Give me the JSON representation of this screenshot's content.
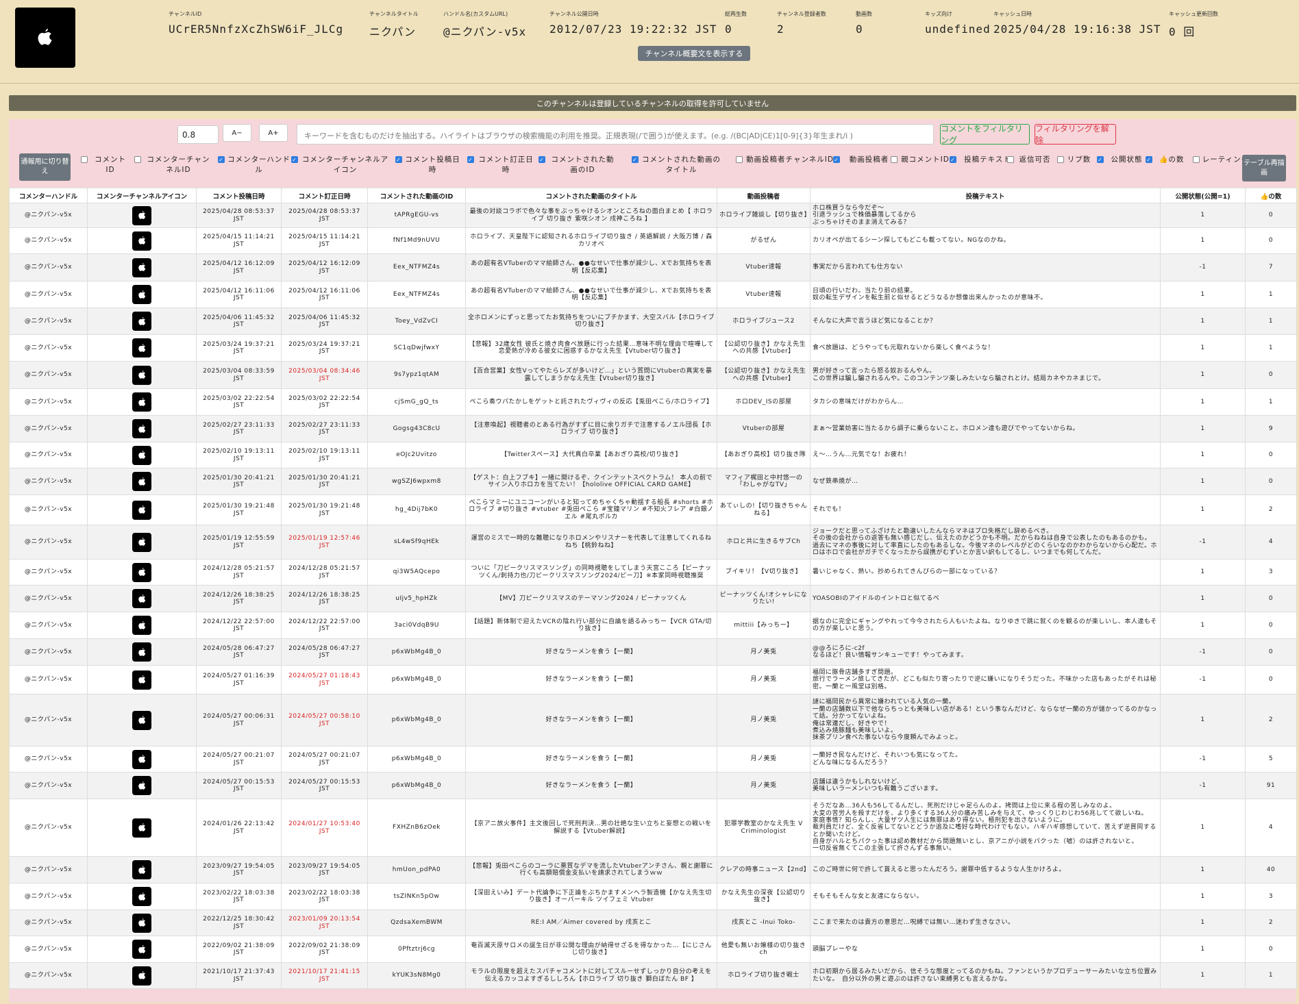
{
  "channel": {
    "icon": "apple-icon",
    "fields": [
      {
        "label": "チャンネルID",
        "value": "UCrER5NnfzXcZhSW6iF_JLCg"
      },
      {
        "label": "チャンネルタイトル",
        "value": "ニクパン"
      },
      {
        "label": "ハンドル名(カスタムURL)",
        "value": "@ニクパン-v5x"
      },
      {
        "label": "チャンネル公開日時",
        "value": "2012/07/23 19:22:32 JST"
      },
      {
        "label": "総再生数",
        "value": "0"
      },
      {
        "label": "チャンネル登録者数",
        "value": "2"
      },
      {
        "label": "動画数",
        "value": "0"
      },
      {
        "label": "キッズ向け",
        "value": "undefined"
      },
      {
        "label": "キャッシュ日時",
        "value": "2025/04/28 19:16:38 JST"
      },
      {
        "label": "キャッシュ更新回数",
        "value": "0 回"
      }
    ],
    "desc_button": "チャンネル概要文を表示する"
  },
  "notice": "このチャンネルは登録しているチャンネルの取得を許可していません",
  "filter": {
    "zoom_value": "0.8",
    "zoom_out": "A−",
    "zoom_in": "A+",
    "keyword_placeholder": "キーワードを含むものだけを抽出する。ハイライトはブラウザの検索機能の利用を推奨。正規表現(/で囲う)が使えます。(e.g. /(BC|AD|CE)1[0-9]{3}年生まれ/i )",
    "filter_button": "コメントをフィルタリング",
    "clear_button": "フィルタリングを解除",
    "mode_button": "通報用に切り替え",
    "redraw_button": "テーブル再描画",
    "checkboxes": [
      {
        "label": "コメント ID",
        "checked": false
      },
      {
        "label": "コメンターチャンネルID",
        "checked": false
      },
      {
        "label": "コメンターハンドル",
        "checked": true
      },
      {
        "label": "コメンターチャンネルアイコン",
        "checked": true
      },
      {
        "label": "コメント投稿日時",
        "checked": true
      },
      {
        "label": "コメント訂正日時",
        "checked": true
      },
      {
        "label": "コメントされた動画のID",
        "checked": true
      },
      {
        "label": "コメントされた動画のタイトル",
        "checked": true
      },
      {
        "label": "動画投稿者チャンネルID",
        "checked": false
      },
      {
        "label": "動画投稿者",
        "checked": true
      },
      {
        "label": "親コメントID",
        "checked": false
      },
      {
        "label": "投稿テキスト",
        "checked": true
      },
      {
        "label": "返信可否",
        "checked": false
      },
      {
        "label": "リプ数",
        "checked": false
      },
      {
        "label": "公開状態",
        "checked": true
      },
      {
        "label": "👍の数",
        "checked": true
      },
      {
        "label": "レーティング",
        "checked": false
      }
    ]
  },
  "table": {
    "headers": [
      "コメンターハンドル",
      "コメンターチャンネルアイコン",
      "コメント投稿日時",
      "コメント訂正日時",
      "コメントされた動画のID",
      "コメントされた動画のタイトル",
      "動画投稿者",
      "投稿テキスト",
      "公開状態(公開=1)",
      "👍の数"
    ],
    "rows": [
      {
        "handle": "@ニクパン-v5x",
        "posted": "2025/04/28 08:53:37 JST",
        "edited": "2025/04/28 08:53:37 JST",
        "edited_red": false,
        "vid": "tAPRgEGU-vs",
        "title": "最後の対談コラボで色々な事をぶっちゃけるシオンところねの面白まとめ【 ホロライブ 切り抜き 紫咲シオン 戌神ころね 】",
        "uploader": "ホロライブ雑談し【切り抜き】",
        "text": "ホロ株買うなら今だぞ～\n引退ラッシュで株価暴落してるから\nぶっちゃけそのまま消えてみる？",
        "state": "1",
        "likes": "0",
        "h": 36
      },
      {
        "handle": "@ニクパン-v5x",
        "posted": "2025/04/15 11:14:21 JST",
        "edited": "2025/04/15 11:14:21 JST",
        "edited_red": false,
        "vid": "fNf1Md9nUVU",
        "title": "ホロライブ、天皇陛下に認知されるホロライブ切り抜き / 英語解説 / 大阪万博 / 森カリオペ",
        "uploader": "がるぜん",
        "text": "カリオペが出てるシーン探してもどこも載ってない。NGなのかね。",
        "state": "1",
        "likes": "0",
        "h": 38
      },
      {
        "handle": "@ニクパン-v5x",
        "posted": "2025/04/12 16:12:09 JST",
        "edited": "2025/04/12 16:12:09 JST",
        "edited_red": false,
        "vid": "Eex_NTFMZ4s",
        "title": "あの超有名VTuberのママ絵師さん、●●なせいで仕事が減少し、Xでお気持ちを表明【反応集】",
        "uploader": "Vtuber速報",
        "text": "事実だから言われても仕方ない",
        "state": "-1",
        "likes": "7",
        "h": 40
      },
      {
        "handle": "@ニクパン-v5x",
        "posted": "2025/04/12 16:11:06 JST",
        "edited": "2025/04/12 16:11:06 JST",
        "edited_red": false,
        "vid": "Eex_NTFMZ4s",
        "title": "あの超有名VTuberのママ絵師さん、●●なせいで仕事が減少し、Xでお気持ちを表明【反応集】",
        "uploader": "Vtuber速報",
        "text": "日頃の行いだわ。当たり前の結果。\n奴の転生デザインを転生前と似せるとどうなるか想像出来んかったのが意味不。",
        "state": "1",
        "likes": "1",
        "h": 39
      },
      {
        "handle": "@ニクパン-v5x",
        "posted": "2025/04/06 11:45:32 JST",
        "edited": "2025/04/06 11:45:32 JST",
        "edited_red": false,
        "vid": "Toey_VdZvCI",
        "title": "全ホロメンにずっと思ってたお気持ちをついにブチかます、大空スバル【ホロライブ切り抜き】",
        "uploader": "ホロライブジュース2",
        "text": "そんなに大声で言うほど気になることか？",
        "state": "1",
        "likes": "1",
        "h": 39
      },
      {
        "handle": "@ニクパン-v5x",
        "posted": "2025/03/24 19:37:21 JST",
        "edited": "2025/03/24 19:37:21 JST",
        "edited_red": false,
        "vid": "SC1qDwjfwxY",
        "title": "【悲報】32歳女性 彼氏と焼き肉食べ放題に行った結果…意味不明な理由で喧嘩して恋愛熱が冷める彼女に困惑するかなえ先生【Vtuber切り抜き】",
        "uploader": "【公認切り抜き】かなえ先生への共感【Vtuber】",
        "text": "食べ放題は、どうやっても元取れないから楽しく食べような！",
        "state": "1",
        "likes": "1",
        "h": 39
      },
      {
        "handle": "@ニクパン-v5x",
        "posted": "2025/03/04 08:33:59 JST",
        "edited": "2025/03/04 08:34:46 JST",
        "edited_red": true,
        "vid": "9s7ypz1qtAM",
        "title": "【百合営業】女性Vってやたらレズが多いけど…」という質問にVtuberの真実を暴露してしまうかなえ先生【Vtuber切り抜き】",
        "uploader": "【公認切り抜き】かなえ先生への共感【Vtuber】",
        "text": "男が好きって言ったら怒る奴おるんやん。\nこの世界は騙し騙されるんや。このコンテンツ楽しみたいなら騙されとけ。結局カネやカネまじで。",
        "state": "1",
        "likes": "0",
        "h": 40
      },
      {
        "handle": "@ニクパン-v5x",
        "posted": "2025/03/02 22:22:54 JST",
        "edited": "2025/03/02 22:22:54 JST",
        "edited_red": false,
        "vid": "cjSmG_gQ_ts",
        "title": "ぺこら奏ウパたかしをゲットと託されたヴィヴィの反応【兎田ぺこら/ホロライブ】",
        "uploader": "ホロDEV_ISの部屋",
        "text": "タカシの意味だけがわからん…",
        "state": "1",
        "likes": "1",
        "h": 39
      },
      {
        "handle": "@ニクパン-v5x",
        "posted": "2025/02/27 23:11:33 JST",
        "edited": "2025/02/27 23:11:33 JST",
        "edited_red": false,
        "vid": "Gogsg43C8cU",
        "title": "【注意喚起】視聴者のとある行為がすずに目に余りガチで注意するノエル団長【ホロライブ 切り抜き】",
        "uploader": "Vtuberの部屋",
        "text": "まぁ～営業妨害に当たるから調子に乗らないこと。ホロメン達も遊びでやってないからね。",
        "state": "1",
        "likes": "9",
        "h": 39
      },
      {
        "handle": "@ニクパン-v5x",
        "posted": "2025/02/10 19:13:11 JST",
        "edited": "2025/02/10 19:13:11 JST",
        "edited_red": false,
        "vid": "eOJc2Uvitzo",
        "title": "【Twitterスペース】大代真白卒業【あおぎり高校/切り抜き】",
        "uploader": "【あおぎり高校】切り抜き隊",
        "text": "え～…うん…元気でな！お疲れ！",
        "state": "1",
        "likes": "0",
        "h": 38
      },
      {
        "handle": "@ニクパン-v5x",
        "posted": "2025/01/30 20:41:21 JST",
        "edited": "2025/01/30 20:41:21 JST",
        "edited_red": false,
        "vid": "wgSZJ6wpxm8",
        "title": "【ゲスト：白上フブキ】一緒に開けるぞ、クインテットスペクトラム！ 本人の前でサイン入りホロカを当てたい！【hololive OFFICIAL CARD GAME】",
        "uploader": "マフィア梶田と中村悠一の「わしゃがなTV」",
        "text": "なぜ鉄串焼が…",
        "state": "1",
        "likes": "0",
        "h": 39
      },
      {
        "handle": "@ニクパン-v5x",
        "posted": "2025/01/30 19:21:48 JST",
        "edited": "2025/01/30 19:21:48 JST",
        "edited_red": false,
        "vid": "hg_4Dij7bK0",
        "title": "ぺこらマミーにユニコーンがいると知ってめちゃくちゃ動揺する船長 #shorts #ホロライブ #切り抜き #vtuber #兎田ぺこら #宝鐘マリン #不知火フレア #白銀ノエル #尾丸ポルカ",
        "uploader": "あてぃしの!【切り抜きちゃんねる】",
        "text": "それでも！",
        "state": "1",
        "likes": "2",
        "h": 44
      },
      {
        "handle": "@ニクパン-v5x",
        "posted": "2025/01/19 12:55:59 JST",
        "edited": "2025/01/19 12:57:46 JST",
        "edited_red": true,
        "vid": "sL4wSf9qHEk",
        "title": "運営のミスで一時的な難聴になりホロメンやリスナーを代表して注意してくれるねねち【桃鈴ねね】",
        "uploader": "ホロと共に生きるサブCh",
        "text": "ジョークだと思ってふざけたと勘違いしたんならマネはプロ失格だし辞めるべき。\nその後の会社からの返答も無い感じだし、伝えたのかどうかも不明。だからねねは自身で公表したのもあるのかも。\n過去にマネの事後に対して率直にしたのもあるしな。今後マネのレベルがどのくらいなのかわからないから心配だ。ホロはホロで会社がガチでくなったから誤携がむずいとか言い訳もしてるし、いつまでも何してんだ。",
        "state": "-1",
        "likes": "4",
        "h": 50
      },
      {
        "handle": "@ニクパン-v5x",
        "posted": "2024/12/28 05:21:57 JST",
        "edited": "2024/12/28 05:21:57 JST",
        "edited_red": false,
        "vid": "qi3W5AQcepo",
        "title": "ついに「刀ピークリスマスソング」の同時視聴をしてしまう天宮こころ【ピーナッツくん/刺持力也/刀ピークリスマスソング2024/ピー刀】※本家同時視聴推奨",
        "uploader": "ブイキリ！【V切り抜き】",
        "text": "暑いじゃなく、熱い。抄められてきんぴらの一部になっている？",
        "state": "1",
        "likes": "3",
        "h": 38
      },
      {
        "handle": "@ニクパン-v5x",
        "posted": "2024/12/26 18:38:25 JST",
        "edited": "2024/12/26 18:38:25 JST",
        "edited_red": false,
        "vid": "uIjv5_hpHZk",
        "title": "【MV】刀ピークリスマスのテーマソング2024 / ピーナッツくん",
        "uploader": "ピーナッツくん!オシャレになりたい!",
        "text": "YOASOBIのアイドルのイントロと似てるべ",
        "state": "1",
        "likes": "0",
        "h": 39
      },
      {
        "handle": "@ニクパン-v5x",
        "posted": "2024/12/22 22:57:00 JST",
        "edited": "2024/12/22 22:57:00 JST",
        "edited_red": false,
        "vid": "3aci0VdqB9U",
        "title": "【話題】新体制で迎えたVCRの陰れ行い部分に自論を語るみっちー【VCR GTA/切り抜き】",
        "uploader": "mittiii【みっちー】",
        "text": "据なのに完全にギャングやれって今今されたら人もいたよね。なりゆきで跳に就くのを観るのが楽しいし、本人達もその方が楽しいと思う。",
        "state": "1",
        "likes": "0",
        "h": 39
      },
      {
        "handle": "@ニクパン-v5x",
        "posted": "2024/05/28 06:47:27 JST",
        "edited": "2024/05/28 06:47:27 JST",
        "edited_red": false,
        "vid": "p6xWbMg4B_0",
        "title": "好きなラーメンを食う【一蘭】",
        "uploader": "月ノ美兎",
        "text": "@@ろにろに-c2f\nなるほど！良い情報サンキューです！やってみます。",
        "state": "-1",
        "likes": "0",
        "h": 39
      },
      {
        "handle": "@ニクパン-v5x",
        "posted": "2024/05/27 01:16:39 JST",
        "edited": "2024/05/27 01:18:43 JST",
        "edited_red": true,
        "vid": "p6xWbMg4B_0",
        "title": "好きなラーメンを食う【一蘭】",
        "uploader": "月ノ美兎",
        "text": "福岡に豚骨店舗多すぎ問題。\n旅行でラーメン旅してきたが、どこも似たり寄ったりで逆に嫌いになりそうだった。不味かった店もあったがそれは秘密。一蘭と一風堂は別格。",
        "state": "-1",
        "likes": "0",
        "h": 42
      },
      {
        "handle": "@ニクパン-v5x",
        "posted": "2024/05/27 00:06:31 JST",
        "edited": "2024/05/27 00:58:10 JST",
        "edited_red": true,
        "vid": "p6xWbMg4B_0",
        "title": "好きなラーメンを食う【一蘭】",
        "uploader": "月ノ美兎",
        "text": "謎に福岡民から異常に嫌われている人気の一蘭。\n一蘭の店舗数以下で他ならちっとも美味しい店がある！という事なんだけど、ならなぜ一蘭の方が儲かってるのかなって話。分かってないよね。\n俺は常連だし、好きやで！\n煮込み焼豚麺も美味しいよ。\n抹茶プリン食べた事ないなら今度頼んでみよっと。",
        "state": "1",
        "likes": "2",
        "h": 76
      },
      {
        "handle": "@ニクパン-v5x",
        "posted": "2024/05/27 00:21:07 JST",
        "edited": "2024/05/27 00:21:07 JST",
        "edited_red": false,
        "vid": "p6xWbMg4B_0",
        "title": "好きなラーメンを食う【一蘭】",
        "uploader": "月ノ美兎",
        "text": "一蘭好き民なんだけど、それいつも気になってた。\nどんな味になるんだろう？",
        "state": "-1",
        "likes": "5",
        "h": 38
      },
      {
        "handle": "@ニクパン-v5x",
        "posted": "2024/05/27 00:15:53 JST",
        "edited": "2024/05/27 00:15:53 JST",
        "edited_red": false,
        "vid": "p6xWbMg4B_0",
        "title": "好きなラーメンを食う【一蘭】",
        "uploader": "月ノ美兎",
        "text": "店舗は違うかもしれないけど、\n美味しいラーメンいつも有難うございます。",
        "state": "-1",
        "likes": "91",
        "h": 39
      },
      {
        "handle": "@ニクパン-v5x",
        "posted": "2024/01/26 22:13:42 JST",
        "edited": "2024/01/27 10:53:40 JST",
        "edited_red": true,
        "vid": "FXHZnB6zOek",
        "title": "【京アニ放火事件】主文後回しで死刑判決…男の壮絶な生い立ちと妄想との戦いを解説する【Vtuber解説】",
        "uploader": "犯罪学教室のかなえ先生 V Criminologist",
        "text": "そうだなあ…36人も56してるんだし、死刑だけじゃ足らんのよ。拷問は上位に来る程の苦しみなのよ。\n大変の苦労人を殺すだけを、より多くする36人分の痛み苦しみを与えて、ゆっくりじわじわ56兆してて欲しいね。\n家庭事情？知らんし、大量ザツ人生には無罪はあり得ない。極刑犯を出さないように。\n裁判員だけど、全く反省してないとどうか追及に嗜好な時代わけでもない。ハギハギ感想していて、苦えず逆買同するとか聞いたけど。\n自身がハルとちパクった事は認め教材だから問題無いとし、京アニが小説をパクった（嘘）のは許されないと。\n一切反省無くてこの主張して許さんずる事無い。",
        "state": "1",
        "likes": "4",
        "h": 84
      },
      {
        "handle": "@ニクパン-v5x",
        "posted": "2023/09/27 19:54:05 JST",
        "edited": "2023/09/27 19:54:05 JST",
        "edited_red": false,
        "vid": "hmUon_pdPA0",
        "title": "【悲報】兎田ぺこらのコーラに悪質なデマを流したVtuberアンチさん、親と謝罪に行くも高額賠償金支払いを請求されてしまうｗｗ",
        "uploader": "クレアの時事ニュース【2nd】",
        "text": "このご時世に何で許して貰えると思ったんだろう。謝罪中低するような人生かけろよ。",
        "state": "1",
        "likes": "40",
        "h": 39
      },
      {
        "handle": "@ニクパン-v5x",
        "posted": "2023/02/22 18:03:38 JST",
        "edited": "2023/02/22 18:03:38 JST",
        "edited_red": false,
        "vid": "tsZINKn5pOw",
        "title": "【深田えいみ】デート代論争に下正論をぶちかますメンヘラ製造機【かなえ先生切り抜き】オーバーキル ツイフェミ Vtuber",
        "uploader": "かなえ先生の深夜【公認切り抜き】",
        "text": "そもそもそんな女と友達にならない。",
        "state": "1",
        "likes": "3",
        "h": 39
      },
      {
        "handle": "@ニクパン-v5x",
        "posted": "2022/12/25 18:30:42 JST",
        "edited": "2023/01/09 20:13:54 JST",
        "edited_red": true,
        "vid": "QzdsaXemBWM",
        "title": "RE:I AM／Aimer covered by 戌亥とこ",
        "uploader": "戌亥とこ -Inui Toko-",
        "text": "ここまで来たのは貴方の意思だ…呪縛では無い…迷わず生きなさい。",
        "state": "1",
        "likes": "2",
        "h": 38
      },
      {
        "handle": "@ニクパン-v5x",
        "posted": "2022/09/02 21:38:09 JST",
        "edited": "2022/09/02 21:38:09 JST",
        "edited_red": false,
        "vid": "0Pftztrj6cg",
        "title": "奄百滅天原サロメの誕生日が非公開な理由が納得せざるを得なかった…【にじさんじ切り抜き】",
        "uploader": "他愛も無いお嬢様の切り抜きch",
        "text": "頭脳プレーやな",
        "state": "1",
        "likes": "0",
        "h": 39
      },
      {
        "handle": "@ニクパン-v5x",
        "posted": "2021/10/17 21:37:43 JST",
        "edited": "2021/10/17 21:41:15 JST",
        "edited_red": true,
        "vid": "kYUK3sN8Mg0",
        "title": "モラルの限度を超えたスパチャコメントに対してスルーせずしっかり自分の考えを伝えるカッコよすぎるししろん【ホロライブ 切り抜き 獅白ぼたん BF 】",
        "uploader": "ホロライブ切り抜き戦士",
        "text": "ホロ初期から居るみたいだから、信そうな態度とってるのかもね。ファンというかプロデューサーみたいな立ち位置みたいな。　自分以外の男と遊ぶのは許さない束縛男とも言えるかな。",
        "state": "1",
        "likes": "1",
        "h": 38
      }
    ]
  }
}
